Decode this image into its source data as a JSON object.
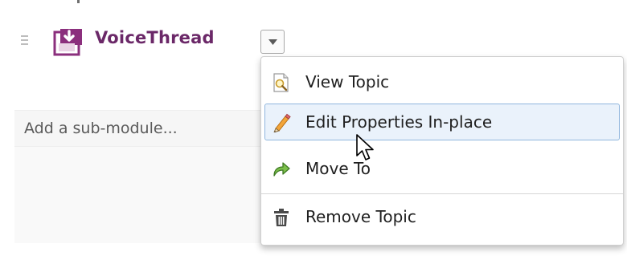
{
  "topic": {
    "title": "VoiceThread",
    "icon": "topic-import-icon",
    "color": "#6b2868"
  },
  "sub_module": {
    "placeholder_text": "Add a sub-module..."
  },
  "menu": {
    "items": [
      {
        "label": "View Topic",
        "icon": "view-topic-icon"
      },
      {
        "label": "Edit Properties In-place",
        "icon": "pencil-icon",
        "state": "hovered"
      },
      {
        "label": "Move To",
        "icon": "move-arrow-icon"
      },
      {
        "label": "Remove Topic",
        "icon": "trash-icon"
      }
    ]
  },
  "colors": {
    "menu_highlight_bg": "#eaf2fb",
    "menu_highlight_border": "#90b6dd"
  }
}
